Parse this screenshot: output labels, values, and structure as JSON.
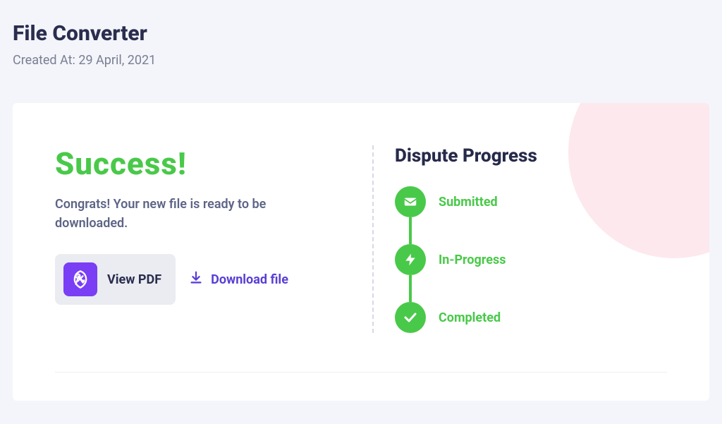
{
  "header": {
    "title": "File Converter",
    "subtitle": "Created At: 29 April, 2021"
  },
  "success": {
    "title": "Success!",
    "message": "Congrats! Your new file is ready to be downloaded.",
    "view_pdf_label": "View PDF",
    "download_label": "Download file"
  },
  "progress": {
    "title": "Dispute Progress",
    "steps": [
      {
        "label": "Submitted"
      },
      {
        "label": "In-Progress"
      },
      {
        "label": "Completed"
      }
    ]
  }
}
